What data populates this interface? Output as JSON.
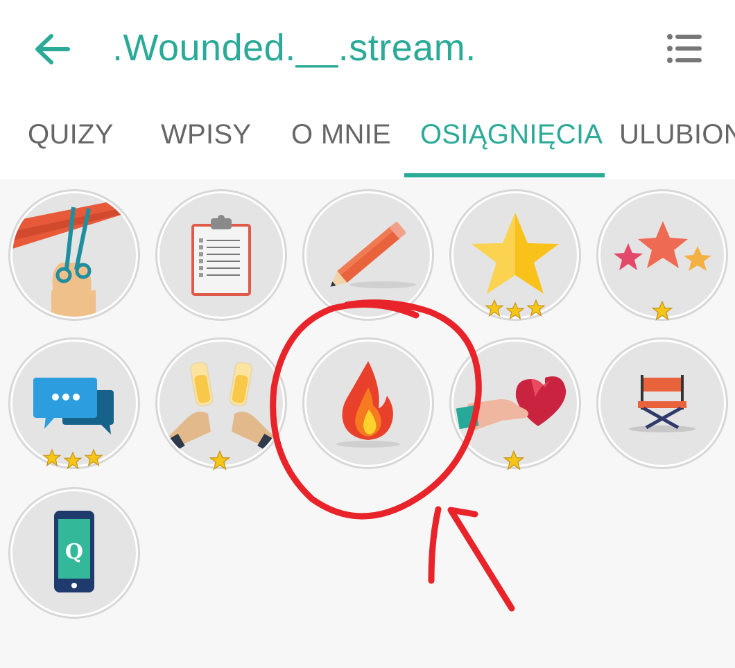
{
  "header": {
    "title": ".Wounded.__.stream.",
    "back_icon": "arrow-left-icon",
    "menu_icon": "list-menu-icon"
  },
  "tabs": [
    {
      "label": "QUIZY",
      "active": false
    },
    {
      "label": "WPISY",
      "active": false
    },
    {
      "label": "O MNIE",
      "active": false
    },
    {
      "label": "OSIĄGNIĘCIA",
      "active": true
    },
    {
      "label": "ULUBIONE",
      "active": false
    }
  ],
  "achievements": [
    {
      "icon": "ribbon-scissors-icon",
      "stars": 0
    },
    {
      "icon": "clipboard-checklist-icon",
      "stars": 0
    },
    {
      "icon": "pencil-icon",
      "stars": 0
    },
    {
      "icon": "gold-star-icon",
      "stars": 3
    },
    {
      "icon": "three-stars-icon",
      "stars": 1
    },
    {
      "icon": "chat-bubbles-icon",
      "stars": 3
    },
    {
      "icon": "champagne-toast-icon",
      "stars": 1
    },
    {
      "icon": "fire-icon",
      "stars": 0
    },
    {
      "icon": "heart-gift-icon",
      "stars": 1
    },
    {
      "icon": "director-chair-icon",
      "stars": 0
    },
    {
      "icon": "smartphone-q-icon",
      "stars": 0
    }
  ],
  "annotation": {
    "type": "red-circle-and-arrow",
    "target": "fire-icon",
    "color": "#e8242a"
  },
  "colors": {
    "accent": "#2aaa97",
    "tab_inactive": "#666666",
    "star": "#f5c518"
  }
}
